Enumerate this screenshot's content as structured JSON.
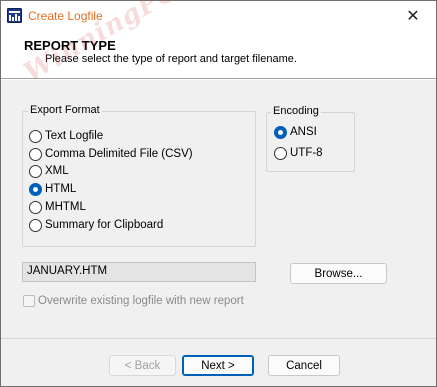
{
  "window": {
    "title": "Create Logfile",
    "close_glyph": "✕",
    "icon": "logfile-app-icon",
    "title_color": "#e07020"
  },
  "header": {
    "title": "REPORT TYPE",
    "subtitle": "Please select the type of report and target filename."
  },
  "watermark": "WinningPC",
  "export_format": {
    "legend": "Export Format",
    "options": [
      {
        "label": "Text Logfile",
        "checked": false
      },
      {
        "label": "Comma Delimited File (CSV)",
        "checked": false
      },
      {
        "label": "XML",
        "checked": false
      },
      {
        "label": "HTML",
        "checked": true
      },
      {
        "label": "MHTML",
        "checked": false
      },
      {
        "label": "Summary for Clipboard",
        "checked": false
      }
    ]
  },
  "encoding": {
    "legend": "Encoding",
    "options": [
      {
        "label": "ANSI",
        "checked": true
      },
      {
        "label": "UTF-8",
        "checked": false
      }
    ]
  },
  "file": {
    "filename": "JANUARY.HTM",
    "browse_label": "Browse...",
    "overwrite_label": "Overwrite existing logfile with new report"
  },
  "footer": {
    "back_label": "< Back",
    "next_label": "Next >",
    "cancel_label": "Cancel"
  },
  "colors": {
    "accent": "#005fb8"
  }
}
